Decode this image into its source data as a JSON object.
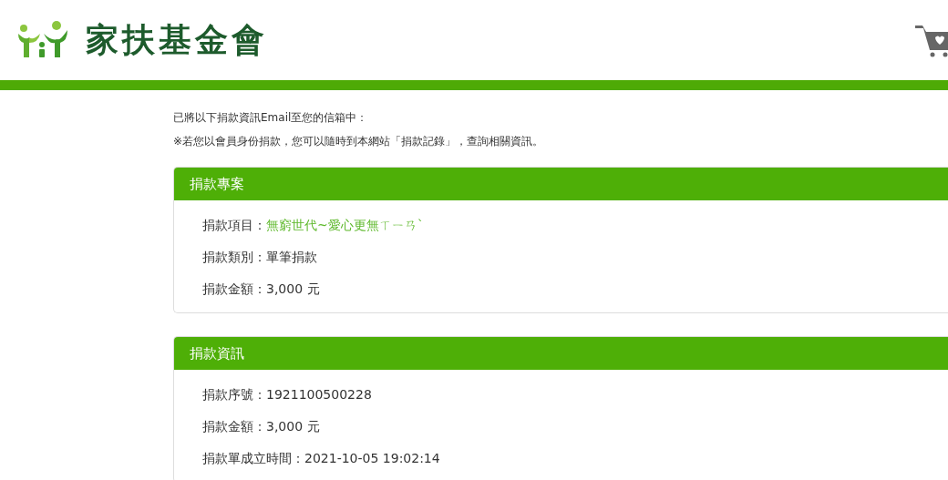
{
  "header": {
    "logo_text": "家扶基金會"
  },
  "notices": [
    "已將以下捐款資訊Email至您的信箱中：",
    "※若您以會員身份捐款，您可以隨時到本網站「捐款記錄」，查詢相關資訊。"
  ],
  "panels": [
    {
      "title": "捐款專案",
      "rows": [
        {
          "label": "捐款項目：",
          "value": "無窮世代~愛心更無ㄒㄧㄢˋ",
          "kind": "accent"
        },
        {
          "label": "捐款類別：",
          "value": "單筆捐款",
          "kind": "plain"
        },
        {
          "label": "捐款金額：",
          "value": "3,000  元",
          "kind": "plain"
        }
      ]
    },
    {
      "title": "捐款資訊",
      "rows": [
        {
          "label": "捐款序號：",
          "value": "1921100500228",
          "kind": "plain"
        },
        {
          "label": "捐款金額：",
          "value": "3,000  元",
          "kind": "plain"
        },
        {
          "label": "捐款單成立時間：",
          "value": "2021-10-05 19:02:14",
          "kind": "plain"
        }
      ]
    }
  ]
}
